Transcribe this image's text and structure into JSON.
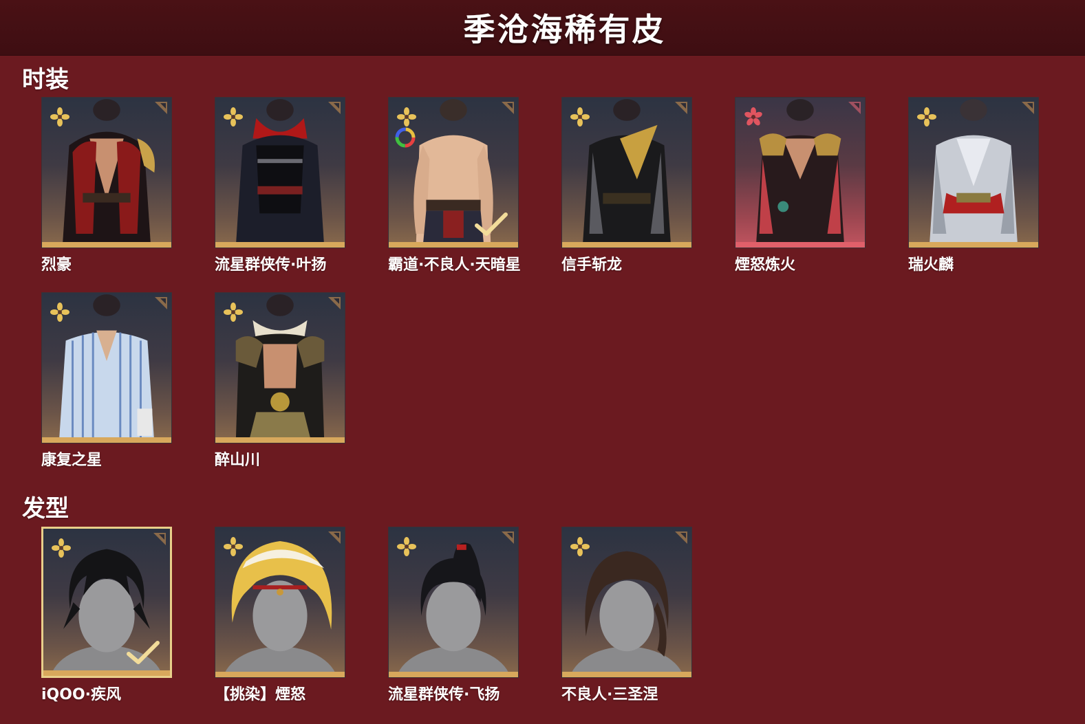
{
  "page_title": "季沧海稀有皮",
  "colors": {
    "background": "#6b1a20",
    "header": "#3e0e12",
    "gold_bar": "#d8a85c",
    "red_bar": "#e0606a",
    "rarity_gold": "#e8c25a",
    "rarity_red": "#e05560"
  },
  "sections": {
    "costumes": {
      "title": "时装",
      "items": [
        {
          "name": "烈豪",
          "rarity_icon": "gold-flower-icon"
        },
        {
          "name": "流星群侠传·叶扬",
          "rarity_icon": "gold-flower-icon"
        },
        {
          "name": "霸道·不良人·天暗星",
          "rarity_icon": "gold-flower-icon",
          "dye_icon": "color-wheel-icon",
          "owned": true
        },
        {
          "name": "信手斩龙",
          "rarity_icon": "gold-flower-icon"
        },
        {
          "name": "煙怒炼火",
          "rarity_icon": "red-flower-icon"
        },
        {
          "name": "瑞火麟",
          "rarity_icon": "gold-flower-icon"
        },
        {
          "name": "康复之星",
          "rarity_icon": "gold-flower-icon"
        },
        {
          "name": "醉山川",
          "rarity_icon": "gold-flower-icon"
        }
      ]
    },
    "hairstyles": {
      "title": "发型",
      "items": [
        {
          "name": "iQOO·疾风",
          "rarity_icon": "gold-flower-icon",
          "owned": true,
          "selected": true
        },
        {
          "name": "【挑染】煙怒",
          "rarity_icon": "gold-flower-icon"
        },
        {
          "name": "流星群侠传·飞扬",
          "rarity_icon": "gold-flower-icon"
        },
        {
          "name": "不良人·三圣涅",
          "rarity_icon": "gold-flower-icon"
        }
      ]
    }
  }
}
